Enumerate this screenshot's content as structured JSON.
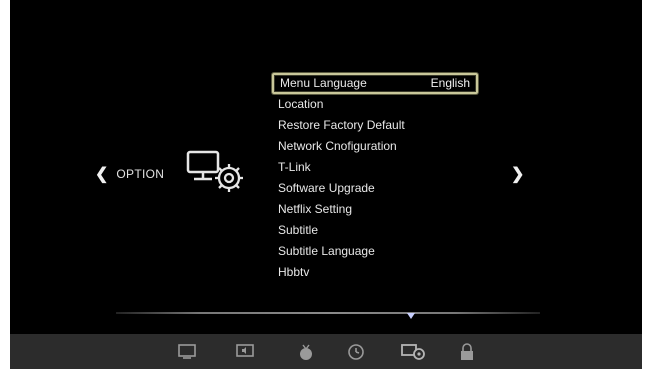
{
  "category": {
    "label": "OPTION",
    "icon": "monitor-gear-icon",
    "prev_icon": "chevron-left-icon",
    "next_icon": "chevron-right-icon"
  },
  "menu": {
    "items": [
      {
        "label": "Menu Language",
        "value": "English",
        "selected": true
      },
      {
        "label": "Location",
        "value": ""
      },
      {
        "label": "Restore Factory Default",
        "value": ""
      },
      {
        "label": "Network Cnofiguration",
        "value": ""
      },
      {
        "label": "T-Link",
        "value": ""
      },
      {
        "label": "Software Upgrade",
        "value": ""
      },
      {
        "label": "Netflix Setting",
        "value": ""
      },
      {
        "label": "Subtitle",
        "value": ""
      },
      {
        "label": "Subtitle Language",
        "value": ""
      },
      {
        "label": "Hbbtv",
        "value": ""
      }
    ]
  },
  "bottom_tabs": [
    {
      "icon": "picture-icon"
    },
    {
      "icon": "sound-icon"
    },
    {
      "icon": "channel-icon"
    },
    {
      "icon": "clock-icon"
    },
    {
      "icon": "option-icon",
      "active": true
    },
    {
      "icon": "lock-icon"
    }
  ],
  "colors": {
    "background": "#000000",
    "text": "#e8e8e8",
    "highlight_border": "#c9c79a",
    "scroll_marker": "#c8d0ff",
    "bottom_bar": "#2c2c2c"
  }
}
